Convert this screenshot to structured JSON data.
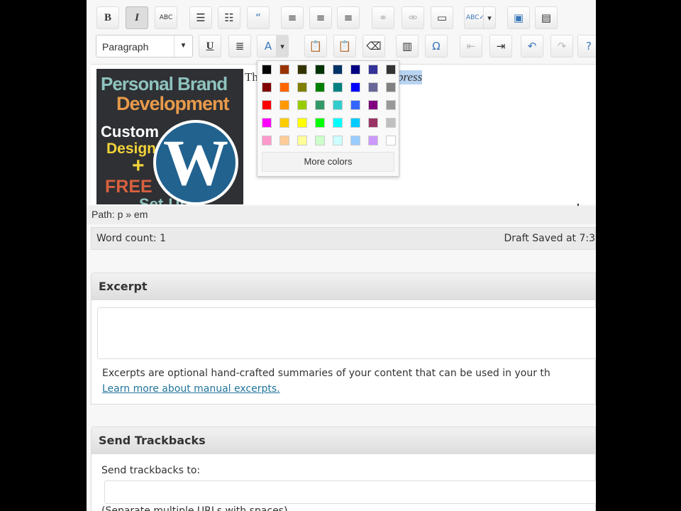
{
  "toolbar": {
    "row1": [
      {
        "name": "bold-button",
        "label": "B"
      },
      {
        "name": "italic-button",
        "label": "I"
      },
      {
        "name": "strikethrough-button",
        "label": "ABC"
      },
      {
        "name": "bullet-list-button",
        "label": "☰"
      },
      {
        "name": "numbered-list-button",
        "label": "☷"
      },
      {
        "name": "blockquote-button",
        "label": "“"
      },
      {
        "name": "align-left-button",
        "label": "≡"
      },
      {
        "name": "align-center-button",
        "label": "≡"
      },
      {
        "name": "align-right-button",
        "label": "≡"
      },
      {
        "name": "insert-link-button",
        "label": "⚭"
      },
      {
        "name": "unlink-button",
        "label": "⚮"
      },
      {
        "name": "more-tag-button",
        "label": "▭"
      },
      {
        "name": "spellcheck-button",
        "label": "ABC✓"
      },
      {
        "name": "spellcheck-dropdown",
        "label": "▾"
      },
      {
        "name": "fullscreen-button",
        "label": "▣"
      },
      {
        "name": "kitchen-sink-button",
        "label": "▤"
      }
    ],
    "format_select": "Paragraph",
    "row2": [
      {
        "name": "underline-button",
        "label": "U"
      },
      {
        "name": "justify-button",
        "label": "≣"
      },
      {
        "name": "text-color-button",
        "label": "A"
      },
      {
        "name": "text-color-dropdown",
        "label": "▾"
      },
      {
        "name": "paste-text-button",
        "label": "📋"
      },
      {
        "name": "paste-word-button",
        "label": "📋"
      },
      {
        "name": "remove-format-button",
        "label": "⌫"
      },
      {
        "name": "insert-media-button",
        "label": "▥"
      },
      {
        "name": "special-char-button",
        "label": "Ω"
      },
      {
        "name": "outdent-button",
        "label": "⇤"
      },
      {
        "name": "indent-button",
        "label": "⇥"
      },
      {
        "name": "undo-button",
        "label": "↶"
      },
      {
        "name": "redo-button",
        "label": "↷"
      },
      {
        "name": "help-button",
        "label": "?"
      }
    ]
  },
  "editor": {
    "text_start": "Th",
    "text_end": "press"
  },
  "image_logo": {
    "line1": "Personal Brand",
    "line2": "Development",
    "line3": "Custom",
    "line4": "Design",
    "line5": "+",
    "line6": "FREE",
    "line7": "Set-Up",
    "mark": "W"
  },
  "color_picker": {
    "colors": [
      "#000000",
      "#993300",
      "#333300",
      "#003300",
      "#003366",
      "#000080",
      "#333399",
      "#333333",
      "#800000",
      "#FF6600",
      "#808000",
      "#008000",
      "#008080",
      "#0000FF",
      "#666699",
      "#808080",
      "#FF0000",
      "#FF9900",
      "#99CC00",
      "#339966",
      "#33CCCC",
      "#3366FF",
      "#800080",
      "#999999",
      "#FF00FF",
      "#FFCC00",
      "#FFFF00",
      "#00FF00",
      "#00FFFF",
      "#00CCFF",
      "#993366",
      "#C0C0C0",
      "#FF99CC",
      "#FFCC99",
      "#FFFF99",
      "#CCFFCC",
      "#CCFFFF",
      "#99CCFF",
      "#CC99FF",
      "#FFFFFF"
    ],
    "more_label": "More colors"
  },
  "status": {
    "path": "Path: p » em",
    "word_count": "Word count: 1",
    "draft_saved": "Draft Saved at 7:3"
  },
  "excerpt": {
    "title": "Excerpt",
    "description": "Excerpts are optional hand-crafted summaries of your content that can be used in your th",
    "link": "Learn more about manual excerpts."
  },
  "trackbacks": {
    "title": "Send Trackbacks",
    "label": "Send trackbacks to:",
    "note": "(Separate multiple URLs with spaces)"
  }
}
